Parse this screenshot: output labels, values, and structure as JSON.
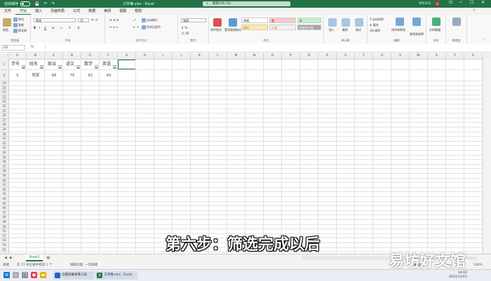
{
  "titlebar": {
    "autosave_label": "自动保存",
    "title": "工作簿.xlsx - Excel",
    "search_placeholder": "搜索(Alt+Q)",
    "user": "AP2314",
    "avatar_letter": "A"
  },
  "tabs": [
    "文件",
    "开始",
    "插入",
    "页面布局",
    "公式",
    "数据",
    "审阅",
    "视图",
    "帮助"
  ],
  "active_tab": "开始",
  "ribbon": {
    "clipboard": {
      "label": "剪贴板",
      "paste": "粘贴",
      "cut": "剪切",
      "copy": "复制",
      "format_painter": "格式刷"
    },
    "font": {
      "label": "字体",
      "font_name": "等线",
      "font_size": "11"
    },
    "alignment": {
      "label": "对齐方式",
      "wrap": "自动换行",
      "merge": "合并后居中"
    },
    "number": {
      "label": "数字",
      "format": "常规"
    },
    "styles": {
      "label": "样式",
      "conditional": "条件格式",
      "table": "套用表格格式",
      "cells": [
        {
          "name": "常规",
          "bg": "#ffffff"
        },
        {
          "name": "差",
          "bg": "#ffc7ce"
        },
        {
          "name": "好",
          "bg": "#c6efce"
        },
        {
          "name": "适中",
          "bg": "#ffeb9c"
        },
        {
          "name": "计算",
          "bg": "#f2f2f2"
        },
        {
          "name": "检查单元格",
          "bg": "#a5a5a5"
        }
      ]
    },
    "cells": {
      "label": "单元格",
      "insert": "插入",
      "delete": "删除",
      "format": "格式"
    },
    "editing": {
      "label": "编辑",
      "autosum": "自动求和",
      "fill": "填充",
      "clear": "清除",
      "sort": "排序和筛选",
      "find": "查找和选择"
    },
    "analysis": {
      "label": "分析",
      "analyze": "分析数据"
    },
    "sensitivity": {
      "label": "敏感度"
    }
  },
  "formula_bar": {
    "name_box": "G2",
    "fx": "fx",
    "value": ""
  },
  "columns": [
    "A",
    "B",
    "C",
    "D",
    "E",
    "F",
    "G",
    "H",
    "I",
    "J",
    "K",
    "L",
    "M",
    "N",
    "O",
    "P",
    "Q",
    "R",
    "S",
    "T",
    "U",
    "V",
    "W",
    "X",
    "Y",
    "Z"
  ],
  "rows_visible": [
    "1",
    "6",
    "19",
    "20",
    "21",
    "22",
    "23",
    "24",
    "25",
    "26",
    "27",
    "28",
    "29",
    "30",
    "31",
    "32",
    "33",
    "34",
    "35",
    "36",
    "37",
    "38",
    "39",
    "40",
    "41",
    "42",
    "43",
    "44",
    "45",
    "46",
    "47",
    "48",
    "49",
    "50",
    "51",
    "52",
    "53",
    "54",
    "55"
  ],
  "table": {
    "headers": [
      "学号",
      "姓名",
      "政治",
      "语文",
      "数学",
      "英语"
    ],
    "rows": [
      [
        "5",
        "程某",
        "88",
        "76",
        "81",
        "99"
      ]
    ]
  },
  "sheets": [
    "Sheet1"
  ],
  "status": {
    "ready": "就绪",
    "record": "在 17 条记录中找到 1 个",
    "accessibility": "辅助功能: 一切就绪",
    "zoom": "100%"
  },
  "taskbar": {
    "apps": [
      "迅捷屏幕录像工具",
      "工作簿.xlsx - Excel"
    ],
    "time": "14:03",
    "date": "2021/11/15"
  },
  "caption": "第六步：筛选完成以后",
  "watermark": "易坊好文馆",
  "colors": {
    "accent": "#217346",
    "selected_border": "#217346"
  }
}
